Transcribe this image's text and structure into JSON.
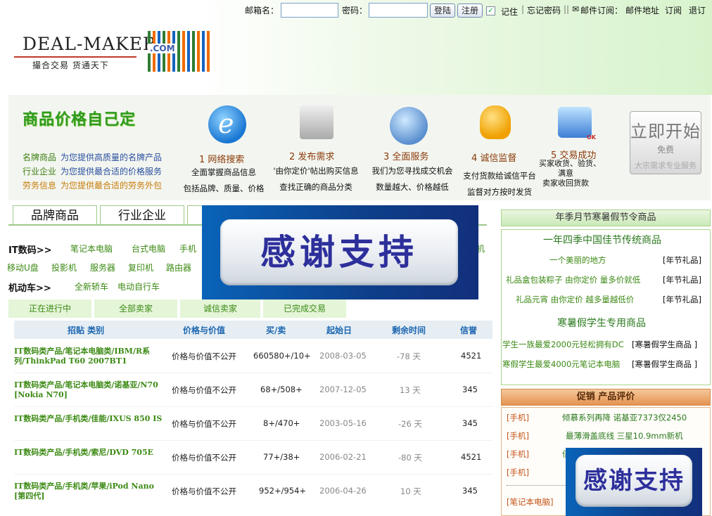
{
  "header": {
    "email_label": "邮箱名：",
    "password_label": "密码：",
    "login_label": "登陆",
    "register_label": "注册",
    "remember_label": "记住",
    "links": [
      "忘记密码",
      "邮件订阅：",
      "邮件地址",
      "订阅",
      "退订"
    ],
    "logo_text": "DEAL-MAKER",
    "logo_slogan": "撮合交易 货通天下",
    "logo_com": ".COM"
  },
  "banner": {
    "slogan": "商品价格自己定",
    "promos": [
      {
        "key": "名牌商品",
        "value": "为您提供高质量的名牌产品"
      },
      {
        "key": "行业企业",
        "value": "为您提供最合适的价格服务"
      },
      {
        "key": "劳务信息",
        "value": "为您提供最合适的劳务外包"
      }
    ],
    "steps": [
      {
        "title": "1 网络搜索",
        "desc": [
          "全面掌握商品信息",
          "包括品牌、质量、价格"
        ]
      },
      {
        "title": "2 发布需求",
        "desc": [
          "'由你定价'帖出购买信息",
          "查找正确的商品分类"
        ]
      },
      {
        "title": "3 全面服务",
        "desc": [
          "我们为您寻找成交机会",
          "数量越大、价格越低"
        ]
      },
      {
        "title": "4 诚信监督",
        "desc": [
          "支付货款给诚信平台",
          "监督对方按时发货"
        ]
      },
      {
        "title": "5 交易成功",
        "desc": [
          "买家收货、验货、",
          "满意",
          "卖家收回货款"
        ]
      }
    ],
    "start": {
      "big": "立即开始",
      "free": "免费",
      "sub": "大宗需求专业服务"
    }
  },
  "tabs": [
    "品牌商品",
    "行业企业"
  ],
  "categories": {
    "it": {
      "heading": "IT数码>>",
      "row1": [
        "笔记本电脑",
        "台式电脑",
        "手机"
      ],
      "row2": [
        "移动U盘",
        "投影机",
        "服务器",
        "复印机",
        "路由器"
      ],
      "tail": "机"
    },
    "moto": {
      "heading": "机动车>>",
      "links": [
        "全新轿车",
        "电动自行车"
      ]
    }
  },
  "subtabs": [
    "正在进行中",
    "全部卖家",
    "诚信卖家",
    "已完成交易"
  ],
  "table": {
    "headers": [
      "招贴 类别",
      "价格与价值",
      "买/卖",
      "起始日",
      "剩余时间",
      "信誉"
    ],
    "rows": [
      {
        "name": "IT数码类产品/笔记本电脑类/IBM/R系列/ThinkPad T60 2007BT1",
        "price": "价格与价值不公开",
        "bs": "660580+/10+",
        "date": "2008-03-05",
        "remain": "-78 天",
        "credit": "4521"
      },
      {
        "name": "IT数码类产品/笔记本电脑类/诺基亚/N70 [Nokia N70]",
        "price": "价格与价值不公开",
        "bs": "68+/508+",
        "date": "2007-12-05",
        "remain": "13 天",
        "credit": "345"
      },
      {
        "name": "IT数码类产品/手机类/佳能/IXUS 850 IS",
        "price": "价格与价值不公开",
        "bs": "8+/470+",
        "date": "2003-05-16",
        "remain": "-26 天",
        "credit": "345"
      },
      {
        "name": "IT数码类产品/手机类/索尼/DVD 705E",
        "price": "价格与价值不公开",
        "bs": "77+/38+",
        "date": "2006-02-21",
        "remain": "-80 天",
        "credit": "4521"
      },
      {
        "name": "IT数码类产品/手机类/苹果/iPod Nano [第四代]",
        "price": "价格与价值不公开",
        "bs": "952+/954+",
        "date": "2006-04-26",
        "remain": "10 天",
        "credit": "345"
      }
    ]
  },
  "sidebar": {
    "season_title": "年季月节寒暑假节令商品",
    "festival_title": "一年四季中国佳节传统商品",
    "festival_items": [
      {
        "text": "一个美丽的地方",
        "tag": "[年节礼品]"
      },
      {
        "text": "礼品盒包装粽子 由你定价 量多价就低",
        "tag": "[年节礼品]"
      },
      {
        "text": "礼品元宵 由你定价 越多量越低价",
        "tag": "[年节礼品]"
      }
    ],
    "student_title": "寒暑假学生专用商品",
    "student_items": [
      {
        "text": "学生一族最爱2000元轻松拥有DC",
        "tag": "[寒暑假学生商品 ]"
      },
      {
        "text": "寒假学生最爱4000元笔记本电脑",
        "tag": "[寒暑假学生商品 ]"
      }
    ],
    "promo_title": "促销 产品评价",
    "promo_items": [
      {
        "tag": "[手机]",
        "text": "倾慕系列再降 诺基亚7373仅2450"
      },
      {
        "tag": "[手机]",
        "text": "最薄滑盖底线 三星10.9mm新机"
      },
      {
        "tag": "[手机]",
        "text": "倍"
      },
      {
        "tag": "[手机]",
        "text": ""
      },
      {
        "tag": "[笔记本电脑]",
        "text": ""
      }
    ]
  },
  "overlays": {
    "thanks": "感谢支持"
  }
}
